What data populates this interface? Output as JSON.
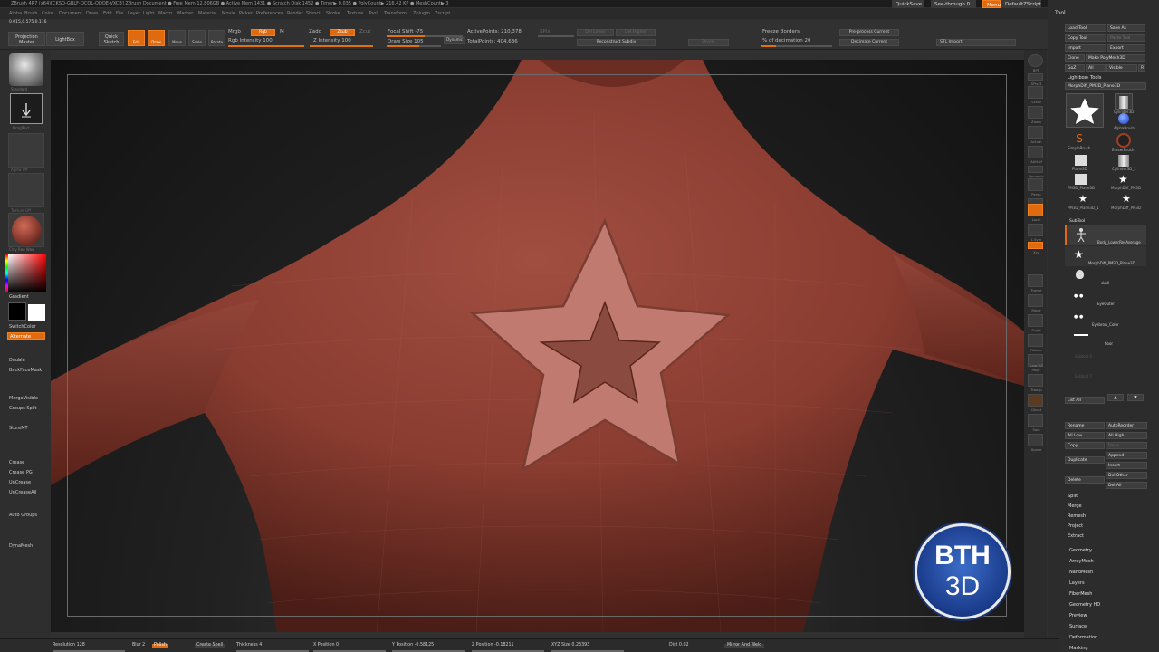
{
  "titlebar": {
    "title": "ZBrush 4R7 (x64)[CKSQ-GBLF-QCQL-QDQE-VXCB]    ZBrush Document    ● Free Mem 12.806GB ● Active Mem 1431 ● Scratch Disk 1452 ● Timer▶ 0.035 ● PolyCount▶ 216.42 KP ● MeshCount▶ 3",
    "quicksave": "QuickSave",
    "seethrough": "See-through  0",
    "menus_btn": "Menus",
    "script": "DefaultZScript"
  },
  "menus": [
    "Alpha",
    "Brush",
    "Color",
    "Document",
    "Draw",
    "Edit",
    "File",
    "Layer",
    "Light",
    "Macro",
    "Marker",
    "Material",
    "Movie",
    "Picker",
    "Preferences",
    "Render",
    "Stencil",
    "Stroke",
    "Texture",
    "Tool",
    "Transform",
    "Zplugin",
    "Zscript"
  ],
  "shelf": {
    "coords": "0.015,0.575,0.116",
    "projection_master": "Projection Master",
    "lightbox": "LightBox",
    "quick_sketch": "Quick Sketch",
    "edit": "Edit",
    "draw": "Draw",
    "move": "Move",
    "scale": "Scale",
    "rotate": "Rotate",
    "mrgb": "Mrgb",
    "rgb": "Rgb",
    "m": "M",
    "rgb_intensity": "Rgb Intensity 100",
    "zadd": "Zadd",
    "zsub": "Zsub",
    "zcut": "Zcut",
    "z_intensity": "Z Intensity 100",
    "focal_shift": "Focal Shift -75",
    "draw_size": "Draw Size 105",
    "dynamic": "Dynamic",
    "active_points": "ActivePoints: 210,378",
    "total_points": "TotalPoints: 404,636",
    "spix": "SPix",
    "del_lower": "Del Lower",
    "del_higher": "Del Higher",
    "reconstruct": "Reconstruct Subdiv",
    "divide": "Divide",
    "freeze_borders": "Freeze Borders",
    "decimation": "% of decimation 20",
    "preprocess": "Pre-process Current",
    "decimate_current": "Decimate Current",
    "stl_import": "STL Import"
  },
  "left": {
    "standard": "Standard",
    "dragrect": "DragRect",
    "alpha_off": "Alpha Off",
    "texture_off": "Texture Off",
    "material": "Clay Red Wax",
    "gradient": "Gradient",
    "switchcolor": "SwitchColor",
    "alternate": "Alternate",
    "double": "Double",
    "backfacemask": "BackFaceMask",
    "merge_visible": "MergeVisible",
    "groups_split": "Groups Split",
    "store_mt": "StoreMT",
    "crease": "Crease",
    "crease_pg": "Crease PG",
    "uncrease": "UnCrease",
    "uncrease_all": "UnCreaseAll",
    "auto_groups": "Auto Groups",
    "dynamesh": "DynaMesh"
  },
  "rstrip": [
    "BPR",
    "SPix 3",
    "Scroll",
    "Zoom",
    "Actual",
    "AAHalf",
    "Dynamic",
    "Persp",
    "Floor",
    "Local",
    "L.Sym",
    "Xyz",
    "Frame",
    "Move",
    "Scale",
    "Rotate",
    "Line Fill PolyF",
    "Transp",
    "Ghost",
    "Solo",
    "Xpose"
  ],
  "panel": {
    "header": "Tool",
    "load_tool": "Load Tool",
    "save_as": "Save As",
    "copy_tool": "Copy Tool",
    "paste_tool": "Paste Tool",
    "import": "Import",
    "export": "Export",
    "clone": "Clone",
    "make_polymesh": "Make PolyMesh3D",
    "goz": "GoZ",
    "all": "All",
    "visible": "Visible",
    "r": "R",
    "lightbox_tools": "Lightbox› Tools",
    "current_tool": "MorphDiff_PM3D_Plane3D",
    "tools": [
      "MorphDiff_PM3D",
      "Cylinder3D",
      "SimpleBrush",
      "AlphaBrush",
      "Plane3D",
      "EraserBrush",
      "Cylinder3D_1",
      "PM3D_Plane3D",
      "MorphDiff_PM3D",
      "PM3D_Plane3D_1",
      "MorphDiff_PM3D"
    ],
    "subtool_header": "SubTool",
    "subtools": [
      "Body_LowerResAverage",
      "MorphDiff_PM3D_Plane3D",
      "skull",
      "EyeOuter",
      "Eyebrow_Color",
      "floor",
      "Subtool 6",
      "Subtool 7"
    ],
    "list_all": "List All",
    "rename": "Rename",
    "autoreorder": "AutoReorder",
    "all_low": "All Low",
    "all_high": "All High",
    "copy": "Copy",
    "paste": "Paste",
    "duplicate": "Duplicate",
    "append": "Append",
    "insert": "Insert",
    "delete": "Delete",
    "del_other": "Del Other",
    "del_all": "Del All",
    "split": "Split",
    "merge": "Merge",
    "remesh": "Remesh",
    "project": "Project",
    "extract": "Extract",
    "sections": [
      "Geometry",
      "ArrayMesh",
      "NanoMesh",
      "Layers",
      "FiberMesh",
      "Geometry HD",
      "Preview",
      "Surface",
      "Deformation",
      "Masking"
    ]
  },
  "bottom": {
    "resolution": "Resolution 128",
    "blur": "Blur 2",
    "polish": "Polish",
    "create_shell": "Create Shell",
    "thickness": "Thickness 4",
    "x_position": "X Position 0",
    "y_position": "Y Position -0.58125",
    "z_position": "Z Position -0.18211",
    "xyz_size": "XYZ Size 0.23393",
    "dist": "Dist 0.02",
    "mirror_weld": "Mirror And Weld"
  },
  "logo": {
    "line1": "BTH",
    "line2": "3D"
  },
  "colors": {
    "accent": "#e06a10",
    "clay": "#8c3d30",
    "logo_blue": "#1c3e8e"
  },
  "bar_levels": {
    "rgb_intensity": 1.0,
    "z_intensity": 1.0,
    "focal_shift": 0.5,
    "draw_size": 0.6,
    "decimation": 0.2
  }
}
